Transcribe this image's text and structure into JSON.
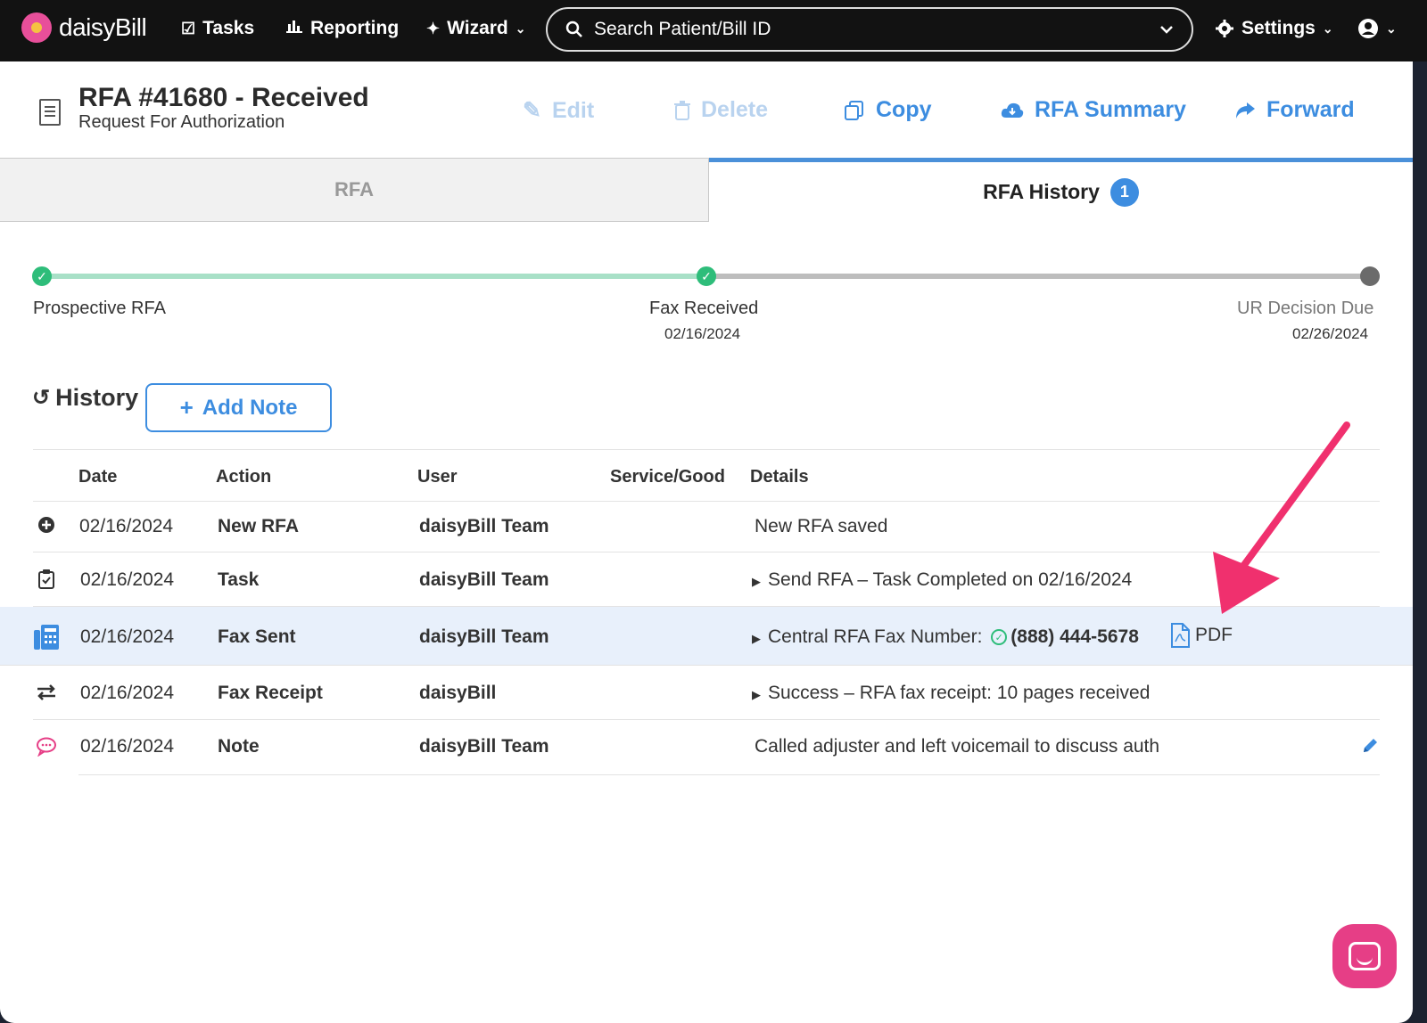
{
  "navbar": {
    "logo": "daisyBill",
    "tasks": "Tasks",
    "reporting": "Reporting",
    "wizard": "Wizard",
    "search_placeholder": "Search Patient/Bill ID",
    "settings": "Settings"
  },
  "header": {
    "title": "RFA #41680 - Received",
    "subtitle": "Request For Authorization",
    "actions": {
      "edit": "Edit",
      "delete": "Delete",
      "copy": "Copy",
      "rfa_summary": "RFA Summary",
      "forward": "Forward"
    }
  },
  "tabs": {
    "rfa": "RFA",
    "history": "RFA History",
    "history_badge": "1"
  },
  "progress": {
    "steps": [
      {
        "label": "Prospective RFA",
        "date": "",
        "status": "done"
      },
      {
        "label": "Fax Received",
        "date": "02/16/2024",
        "status": "done"
      },
      {
        "label": "UR Decision Due",
        "date": "02/26/2024",
        "status": "pending"
      }
    ]
  },
  "history": {
    "title": "History",
    "add_note": "Add Note",
    "columns": [
      "Date",
      "Action",
      "User",
      "Service/Good",
      "Details"
    ],
    "rows": [
      {
        "icon": "plus-circle-icon",
        "date": "02/16/2024",
        "action": "New RFA",
        "user": "daisyBill Team",
        "details": "New RFA saved"
      },
      {
        "icon": "clipboard-check-icon",
        "date": "02/16/2024",
        "action": "Task",
        "user": "daisyBill Team",
        "details": "Send RFA – Task Completed on 02/16/2024"
      },
      {
        "icon": "fax-icon",
        "date": "02/16/2024",
        "action": "Fax Sent",
        "user": "daisyBill Team",
        "details": "Central RFA Fax Number:",
        "details_value": "(888) 444-5678",
        "attachment": "PDF"
      },
      {
        "icon": "exchange-icon",
        "date": "02/16/2024",
        "action": "Fax Receipt",
        "user": "daisyBill",
        "details": "Success – RFA fax receipt: 10 pages received"
      },
      {
        "icon": "comment-icon",
        "date": "02/16/2024",
        "action": "Note",
        "user": "daisyBill Team",
        "details": "Called adjuster and left voicemail to discuss auth"
      }
    ]
  },
  "colors": {
    "accent": "#3d8de0",
    "success": "#2ebd7a",
    "annotation_arrow": "#f0306e",
    "chat": "#e63e86"
  }
}
